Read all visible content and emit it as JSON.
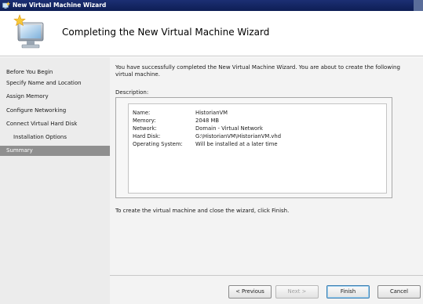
{
  "window": {
    "title": "New Virtual Machine Wizard",
    "icon": "hyperv-wizard-icon"
  },
  "header": {
    "title": "Completing the New Virtual Machine Wizard",
    "icon": "virtual-machine-wizard-icon"
  },
  "sidebar": {
    "items": [
      {
        "label": "Before You Begin"
      },
      {
        "label": "Specify Name and Location"
      },
      {
        "label": "Assign Memory"
      },
      {
        "label": "Configure Networking"
      },
      {
        "label": "Connect Virtual Hard Disk"
      },
      {
        "label": "Installation Options"
      },
      {
        "label": "Summary"
      }
    ],
    "active_index": 6
  },
  "main": {
    "intro": "You have successfully completed the New Virtual Machine Wizard. You are about to create the following virtual machine.",
    "description_label": "Description:",
    "summary": [
      {
        "key": "Name:",
        "value": "HistorianVM"
      },
      {
        "key": "Memory:",
        "value": "2048 MB"
      },
      {
        "key": "Network:",
        "value": "Domain - Virtual Network"
      },
      {
        "key": "Hard Disk:",
        "value": "G:\\HistorianVM\\HistorianVM.vhd"
      },
      {
        "key": "Operating System:",
        "value": "Will be installed at a later time"
      }
    ],
    "finish_note": "To create the virtual machine and close the wizard, click Finish."
  },
  "buttons": {
    "previous": "< Previous",
    "next": "Next >",
    "finish": "Finish",
    "cancel": "Cancel"
  },
  "colors": {
    "titlebar": "#1c2f73",
    "sidebar_bg": "#ececec",
    "active_item": "#8f8f8f",
    "main_bg": "#f3f3f3"
  }
}
